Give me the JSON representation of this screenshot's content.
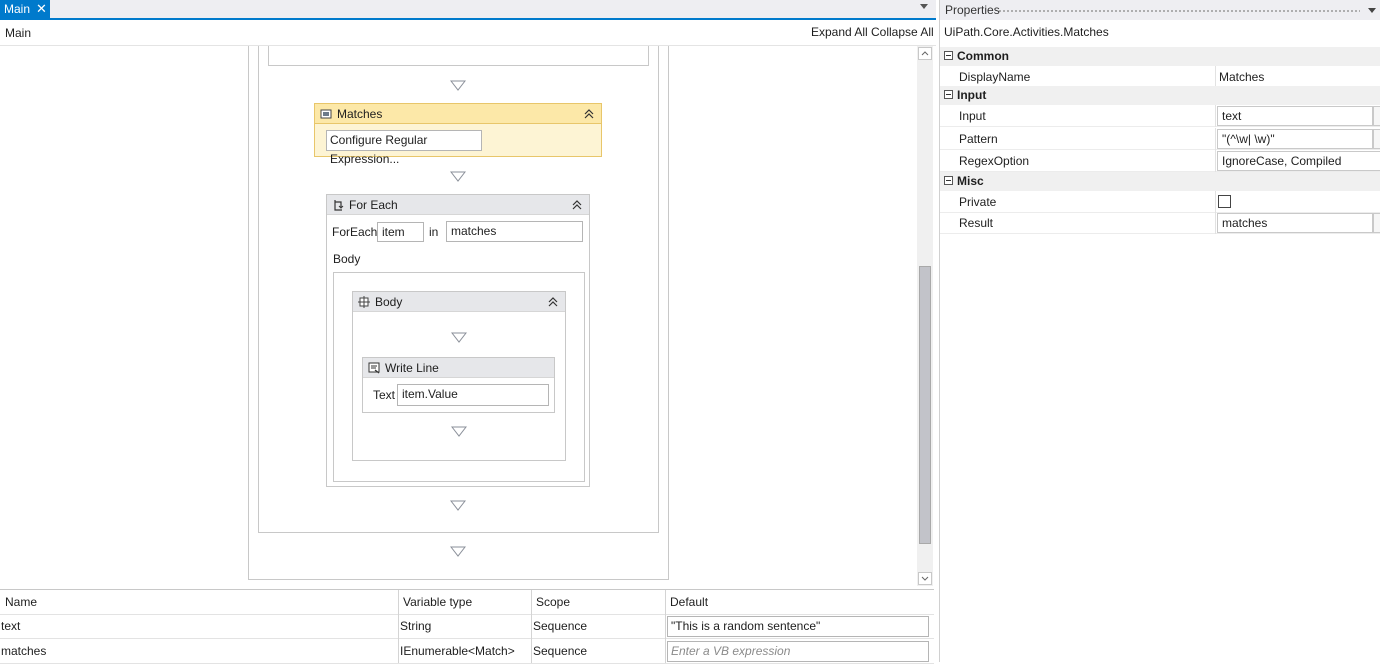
{
  "tab": {
    "label": "Main",
    "close": "✕"
  },
  "breadcrumb": "Main",
  "toolbar": {
    "expand_all": "Expand All",
    "collapse_all": "Collapse All"
  },
  "matches_activity": {
    "title": "Matches",
    "button": "Configure Regular Expression..."
  },
  "foreach_activity": {
    "title": "For Each",
    "foreach_label": "ForEach",
    "item_value": "item",
    "in_label": "in",
    "collection_value": "matches",
    "body_label": "Body"
  },
  "body_sequence": {
    "title": "Body"
  },
  "writeline_activity": {
    "title": "Write Line",
    "text_label": "Text",
    "text_value": "item.Value"
  },
  "variables": {
    "headers": [
      "Name",
      "Variable type",
      "Scope",
      "Default"
    ],
    "rows": [
      {
        "name": "text",
        "type": "String",
        "scope": "Sequence",
        "default": "\"This is a random sentence\""
      },
      {
        "name": "matches",
        "type": "IEnumerable<Match>",
        "scope": "Sequence",
        "default_placeholder": "Enter a VB expression"
      }
    ]
  },
  "properties": {
    "panel_title": "Properties",
    "type_name": "UiPath.Core.Activities.Matches",
    "categories": {
      "common": "Common",
      "input": "Input",
      "misc": "Misc"
    },
    "rows": {
      "display_name": {
        "name": "DisplayName",
        "value": "Matches"
      },
      "input": {
        "name": "Input",
        "value": "text"
      },
      "pattern": {
        "name": "Pattern",
        "value": "\"(^\\w| \\w)\""
      },
      "regex_option": {
        "name": "RegexOption",
        "value": "IgnoreCase, Compiled"
      },
      "private": {
        "name": "Private",
        "checked": false
      },
      "result": {
        "name": "Result",
        "value": "matches"
      }
    }
  },
  "colors": {
    "accent": "#007acc",
    "selected_activity": "#fce8a8",
    "selected_border": "#e8c66a"
  }
}
